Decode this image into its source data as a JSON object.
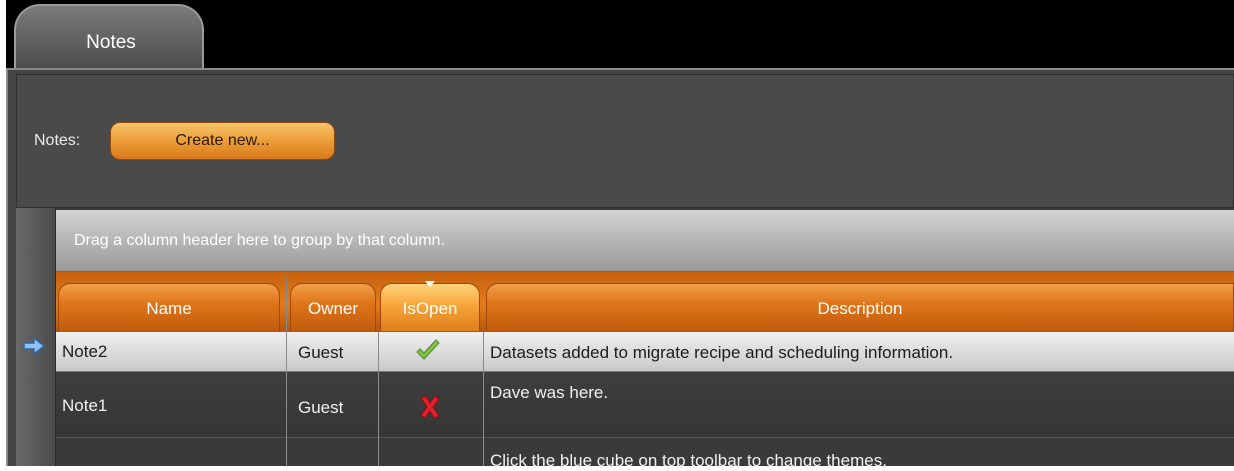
{
  "tab": {
    "label": "Notes"
  },
  "toolbar": {
    "notes_label": "Notes:",
    "create_label": "Create new..."
  },
  "grid": {
    "group_hint": "Drag a column header here to group by that column.",
    "columns": [
      "Name",
      "Owner",
      "IsOpen",
      "Description"
    ],
    "sorted_column": "IsOpen",
    "rows": [
      {
        "name": "Note2",
        "owner": "Guest",
        "is_open": true,
        "is_open_icon": "check-icon",
        "description": "Datasets added to migrate recipe and scheduling information."
      },
      {
        "name": "Note1",
        "owner": "Guest",
        "is_open": false,
        "is_open_icon": "x-icon",
        "description": "Dave was here."
      },
      {
        "name": "",
        "owner": "",
        "is_open": null,
        "description": "Click the blue cube on top toolbar to change themes."
      }
    ]
  },
  "colors": {
    "accent": "#e0761a",
    "panel": "#444444",
    "tab": "#5a5a5a"
  }
}
